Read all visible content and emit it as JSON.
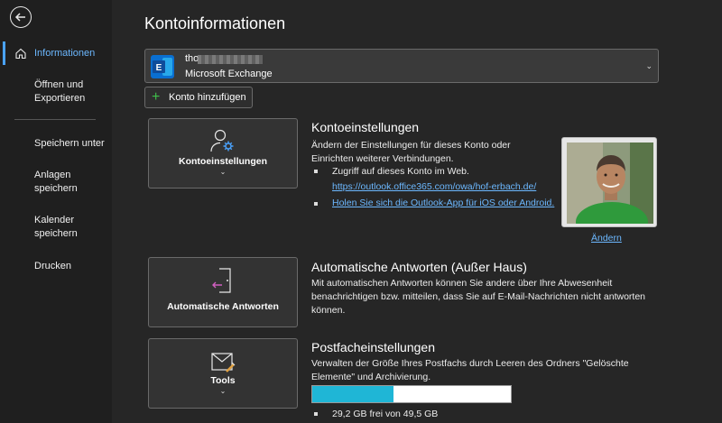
{
  "sidebar": {
    "items": [
      {
        "label": "Informationen",
        "active": true
      },
      {
        "label": "Öffnen und\nExportieren"
      },
      {
        "label": "Speichern unter"
      },
      {
        "label": "Anlagen\nspeichern"
      },
      {
        "label": "Kalender\nspeichern"
      },
      {
        "label": "Drucken"
      }
    ]
  },
  "main": {
    "title": "Kontoinformationen",
    "account": {
      "name_prefix": "tho",
      "type": "Microsoft Exchange"
    },
    "add_account_label": "Konto hinzufügen",
    "sections": [
      {
        "tile_label": "Kontoeinstellungen",
        "title": "Kontoeinstellungen",
        "text": "Ändern der Einstellungen für dieses Konto oder Einrichten weiterer Verbindungen.",
        "bullet1": "Zugriff auf dieses Konto im Web.",
        "link1": "https://outlook.office365.com/owa/hof-erbach.de/",
        "link2": "Holen Sie sich die Outlook-App für iOS oder Android.",
        "photo_action": "Ändern"
      },
      {
        "tile_label": "Automatische Antworten",
        "title": "Automatische Antworten (Außer Haus)",
        "text": "Mit automatischen Antworten können Sie andere über Ihre Abwesenheit benachrichtigen bzw. mitteilen, dass Sie auf E-Mail-Nachrichten nicht antworten können."
      },
      {
        "tile_label": "Tools",
        "title": "Postfacheinstellungen",
        "text": "Verwalten der Größe Ihres Postfachs durch Leeren des Ordners \"Gelöschte Elemente\" und Archivierung.",
        "storage_text": "29,2 GB frei von 49,5 GB",
        "storage_used_fraction": 0.41
      }
    ]
  },
  "colors": {
    "accent": "#4aa3ff",
    "link": "#6cb8ff",
    "progress": "#1fb6d6",
    "exchange_blue": "#0a6fd1"
  }
}
